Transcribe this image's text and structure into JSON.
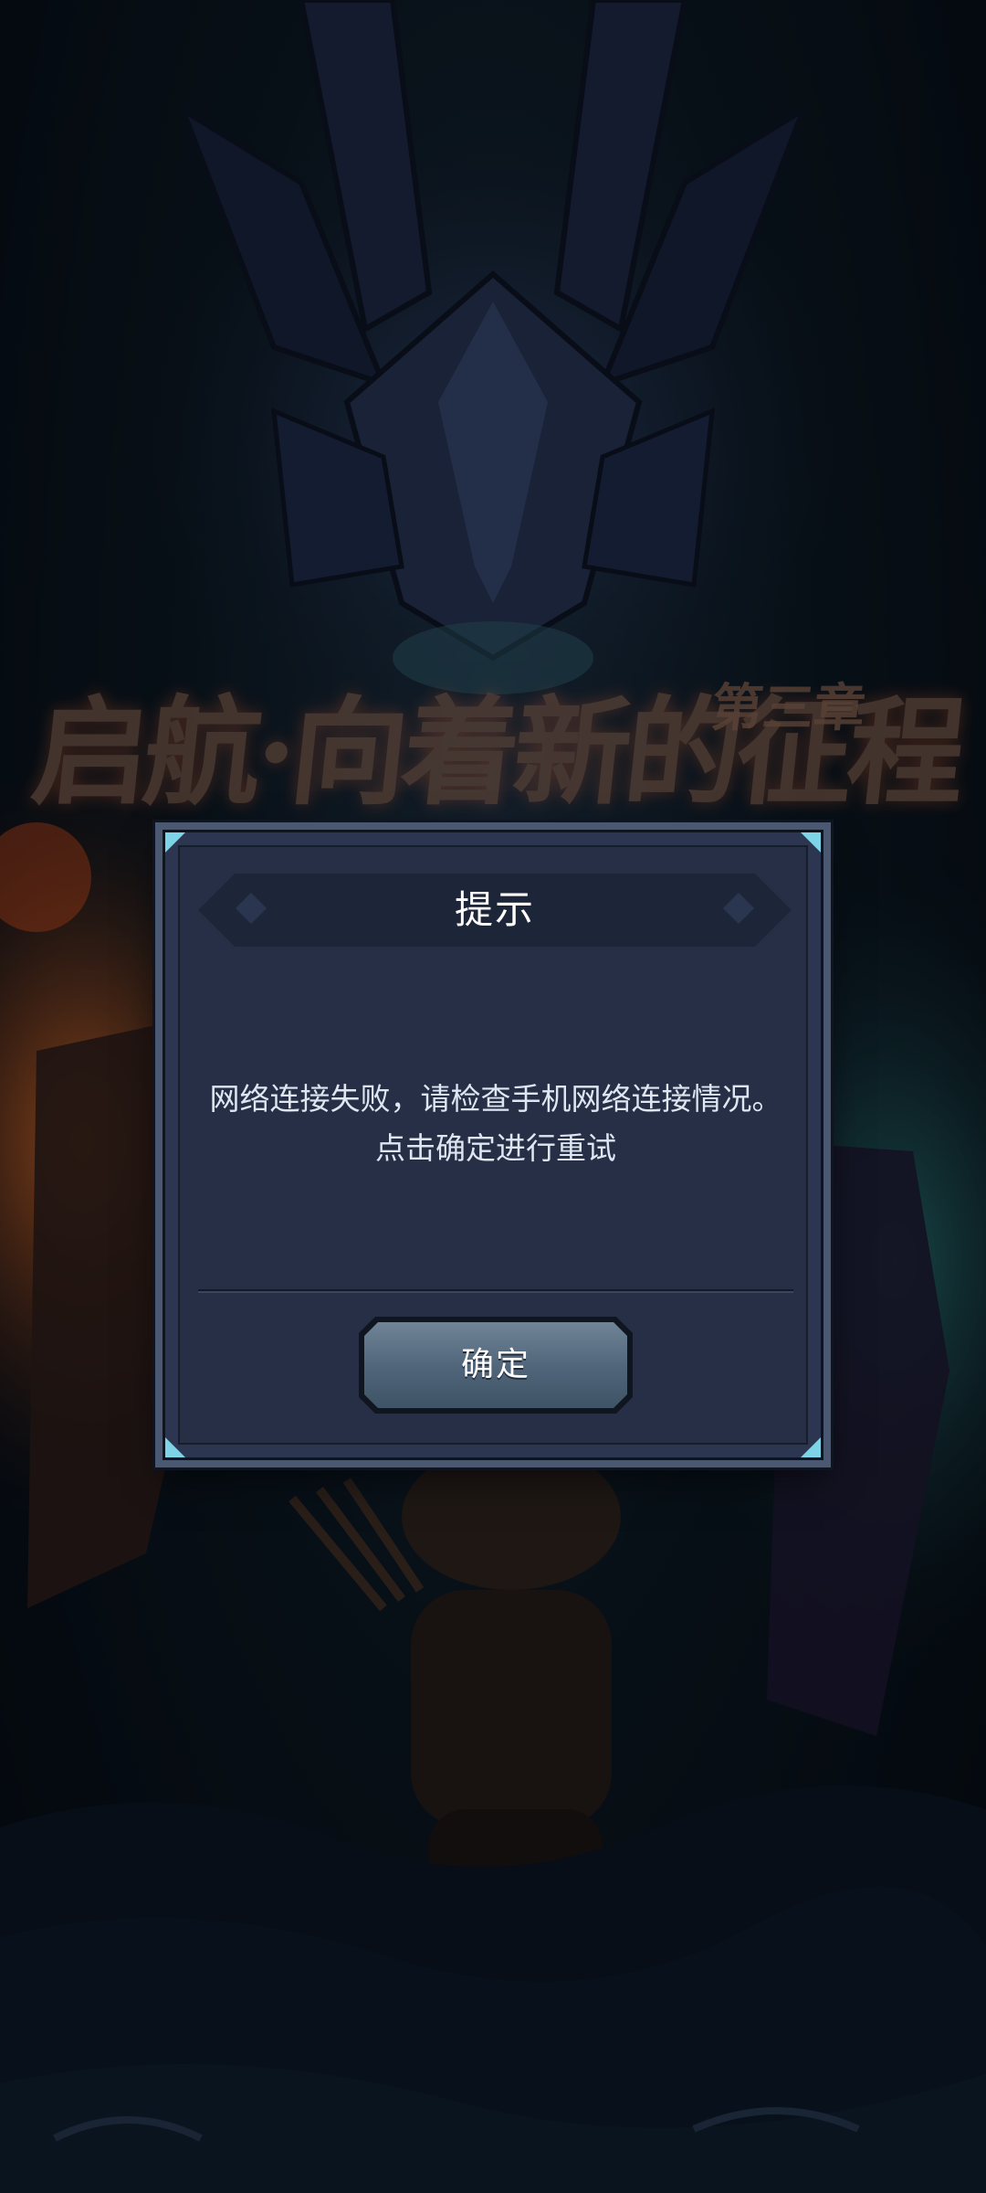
{
  "background": {
    "chapter_title": "启航·向着新的征程",
    "chapter_label": "第三章"
  },
  "dialog": {
    "title": "提示",
    "message_lines": [
      "网络连接失败，请检查手机网络连接情况。",
      "点击确定进行重试"
    ],
    "confirm_label": "确定"
  },
  "colors": {
    "dialog_bg": "#262f45",
    "corner_accent": "#7ed4e6",
    "button_face": "#5a6f83"
  }
}
